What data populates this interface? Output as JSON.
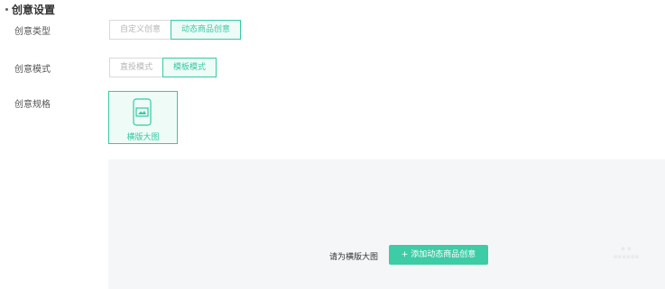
{
  "section": {
    "title": "创意设置"
  },
  "creative_type": {
    "label": "创意类型",
    "options": [
      "自定义创意",
      "动态商品创意"
    ],
    "selected_index": 1
  },
  "creative_mode": {
    "label": "创意模式",
    "options": [
      "直投模式",
      "模板模式"
    ],
    "selected_index": 1
  },
  "creative_spec": {
    "label": "创意规格",
    "card": {
      "label": "横版大图",
      "icon": "phone-image-icon",
      "selected": true
    }
  },
  "preview": {
    "hint": "请为横版大图",
    "add_button": "+ 添加动态商品创意"
  },
  "colors": {
    "accent": "#36c9a5",
    "accent_bg": "#eefbf6",
    "preview_bg": "#f5f6f8"
  }
}
